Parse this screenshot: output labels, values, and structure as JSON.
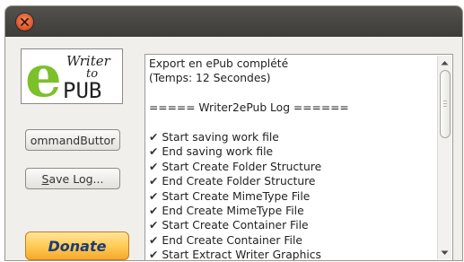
{
  "window": {
    "close_icon": "close-icon"
  },
  "logo": {
    "line1": "Writer",
    "line2": "to",
    "line3": "PUB",
    "letter": "e",
    "accent_color": "#7cc02b"
  },
  "buttons": {
    "command_label": "ommandButtor",
    "save_log_underlined": "S",
    "save_log_rest": "ave Log...",
    "donate_label": "Donate"
  },
  "log": {
    "lines": [
      {
        "check": false,
        "text": "Export en ePub complété"
      },
      {
        "check": false,
        "text": "(Temps: 12 Secondes)"
      },
      {
        "check": false,
        "text": ""
      },
      {
        "check": false,
        "text": "===== Writer2ePub Log ======"
      },
      {
        "check": false,
        "text": ""
      },
      {
        "check": true,
        "text": "Start saving work file"
      },
      {
        "check": true,
        "text": "End saving work file"
      },
      {
        "check": true,
        "text": "Start Create Folder Structure"
      },
      {
        "check": true,
        "text": "End Create Folder Structure"
      },
      {
        "check": true,
        "text": "Start Create MimeType File"
      },
      {
        "check": true,
        "text": "End Create MimeType File"
      },
      {
        "check": true,
        "text": "Start Create Container File"
      },
      {
        "check": true,
        "text": "End Create Container File"
      },
      {
        "check": true,
        "text": "Start Extract Writer Graphics"
      }
    ],
    "check_glyph": "✔"
  }
}
